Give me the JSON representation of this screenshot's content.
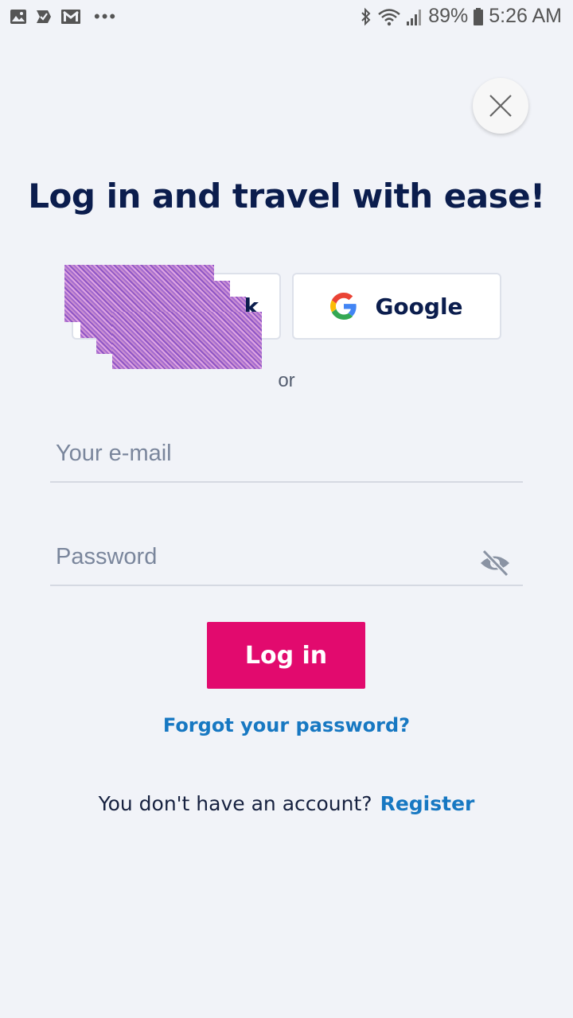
{
  "status_bar": {
    "battery": "89%",
    "time": "5:26 AM",
    "more": "•••"
  },
  "title": "Log in and travel with ease!",
  "social": {
    "facebook_label": "k",
    "google_label": "Google"
  },
  "or_label": "or",
  "email": {
    "placeholder": "Your e-mail",
    "value": ""
  },
  "password": {
    "placeholder": "Password",
    "value": ""
  },
  "login_label": "Log in",
  "forgot_label": "Forgot your password?",
  "register": {
    "prompt": "You don't have an account?",
    "link_label": "Register"
  },
  "colors": {
    "background": "#f1f3f8",
    "title": "#0b1d4d",
    "primary_button": "#e20a6e",
    "link": "#1778c2"
  },
  "icons": {
    "close": "close-icon",
    "google": "google-logo-icon",
    "password_visibility": "eye-off-icon"
  }
}
